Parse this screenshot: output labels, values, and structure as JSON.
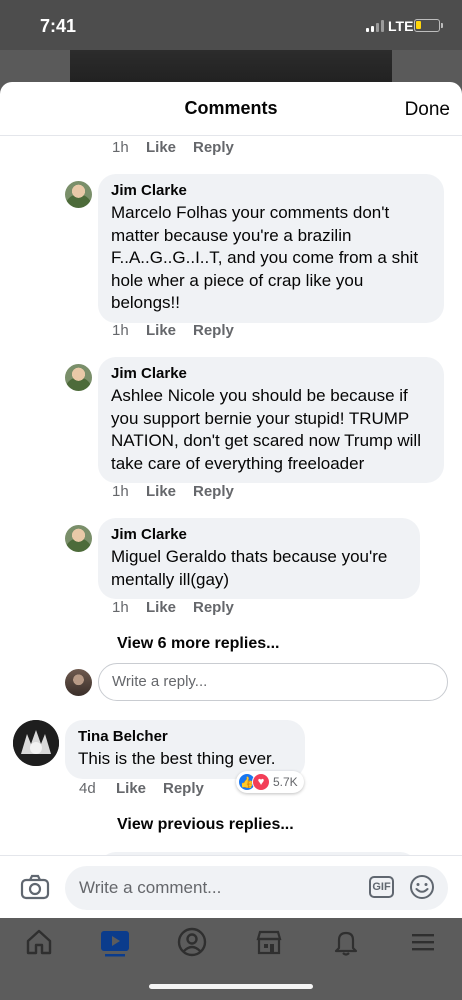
{
  "status": {
    "time": "7:41",
    "network": "LTE",
    "battery_level": 0.2
  },
  "header": {
    "title": "Comments",
    "done_label": "Done"
  },
  "top_meta": {
    "time": "1h",
    "like": "Like",
    "reply": "Reply"
  },
  "replies": [
    {
      "author": "Jim Clarke",
      "text": "Marcelo Folhas your comments don't matter because you're a brazilin F..A..G..G..I..T, and you come from a shit hole wher a piece of crap like you belongs!!",
      "time": "1h",
      "like": "Like",
      "reply": "Reply"
    },
    {
      "author": "Jim Clarke",
      "text": "Ashlee Nicole you should be because if you support bernie your stupid! TRUMP NATION, don't get scared now Trump will take care of everything freeloader",
      "time": "1h",
      "like": "Like",
      "reply": "Reply"
    },
    {
      "author": "Jim Clarke",
      "text": "Miguel Geraldo thats because you're mentally ill(gay)",
      "time": "1h",
      "like": "Like",
      "reply": "Reply"
    }
  ],
  "view_more_replies": "View 6 more replies...",
  "reply_input": {
    "placeholder": "Write a reply..."
  },
  "top_comment": {
    "author": "Tina Belcher",
    "text": "This is the best thing ever.",
    "time": "4d",
    "like": "Like",
    "reply": "Reply",
    "reaction_count": "5.7K"
  },
  "view_previous_replies": "View previous replies...",
  "composer": {
    "placeholder": "Write a comment...",
    "gif_label": "GIF"
  },
  "colors": {
    "accent": "#1877f2",
    "love": "#f33e58",
    "bubble": "#f0f2f5",
    "meta": "#65676b"
  },
  "nav": [
    "home-icon",
    "watch-icon",
    "profile-icon",
    "marketplace-icon",
    "bell-icon",
    "menu-icon"
  ]
}
